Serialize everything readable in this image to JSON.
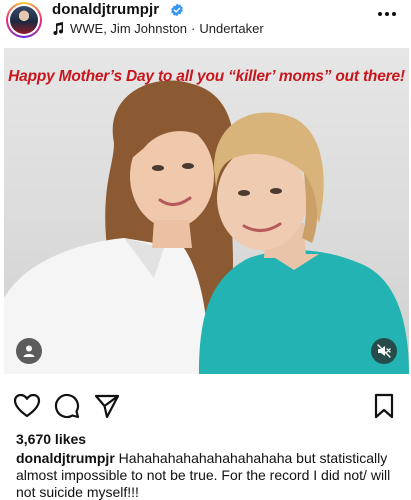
{
  "post": {
    "username": "donaldjtrumpjr",
    "verified": true,
    "music": {
      "artist": "WWE, Jim Johnston",
      "separator": "·",
      "track": "Undertaker"
    },
    "image_caption": "Happy Mother’s Day to all you “killer’ moms” out there!",
    "likes": "3,670 likes",
    "caption_user": "donaldjtrumpjr",
    "caption_text": "Hahahahahahahahahahaha but statistically almost impossible to not be true. For the record I did not/ will not suicide myself!!!"
  },
  "icons": {
    "more": "more-options-icon",
    "like": "heart-icon",
    "comment": "comment-icon",
    "share": "share-icon",
    "save": "bookmark-icon",
    "tagged": "user-tag-icon",
    "mute": "muted-speaker-icon",
    "music": "music-note-icon",
    "verified": "verified-badge-icon"
  },
  "colors": {
    "verified_blue": "#3897f0",
    "banner_red": "#c8161d"
  }
}
